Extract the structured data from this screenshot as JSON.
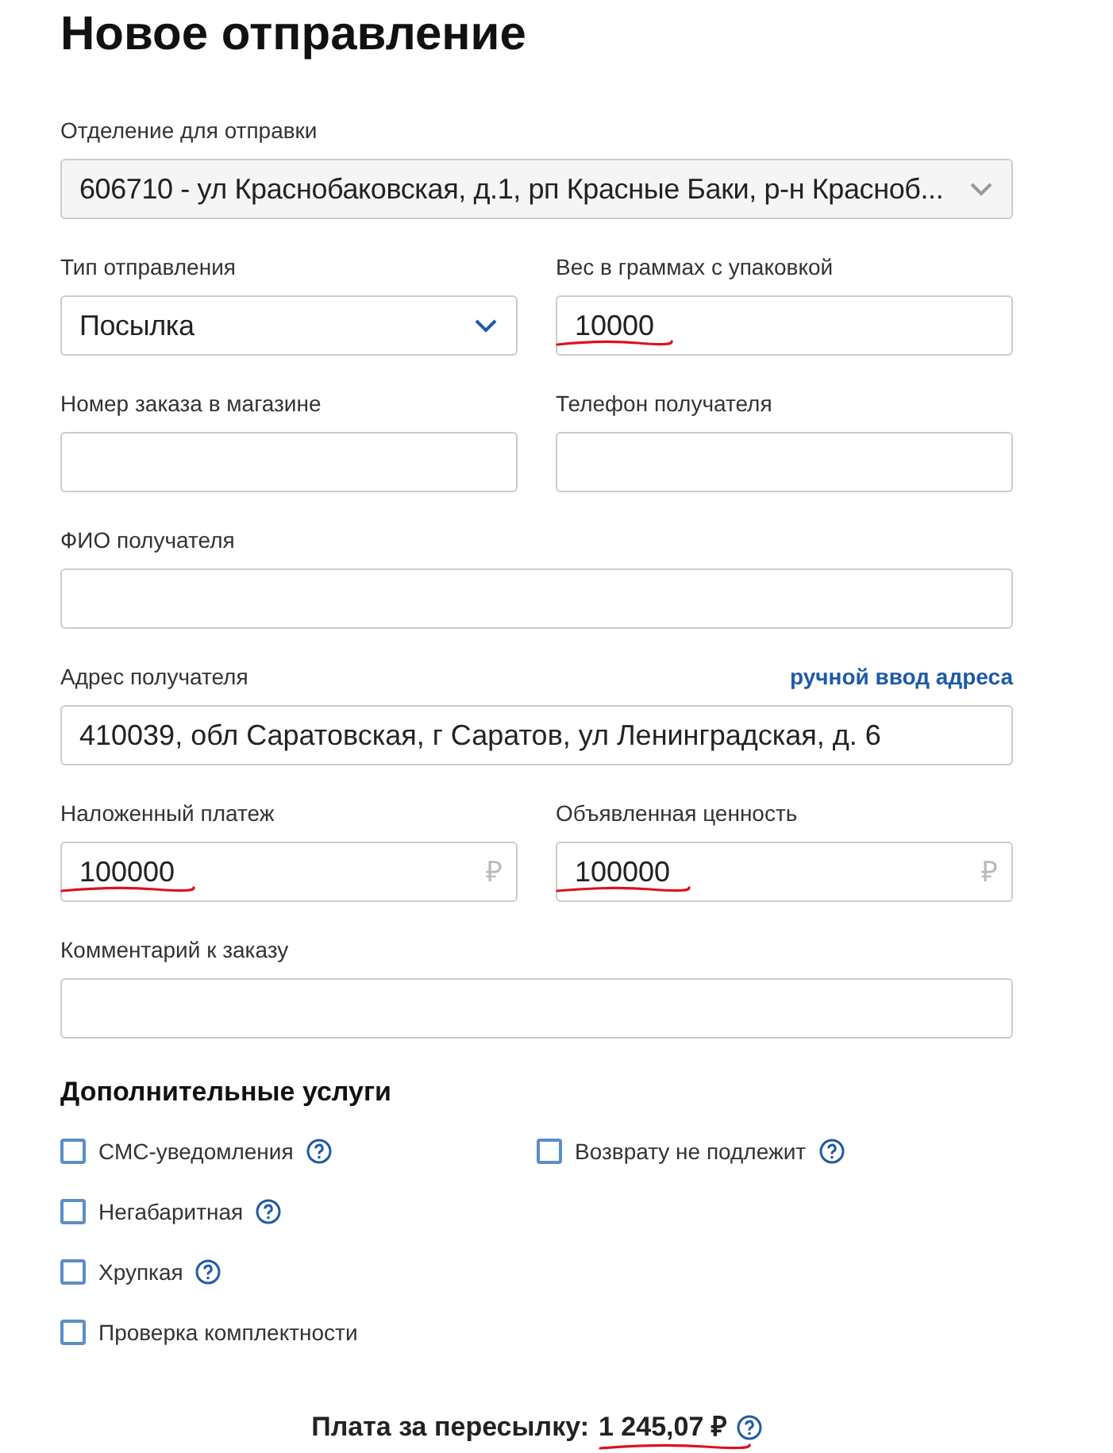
{
  "title": "Новое отправление",
  "rows": [
    [
      {
        "kind": "select",
        "label": "Отделение для отправки",
        "value": "606710 - ул Краснобаковская, д.1, рп Красные Баки, р-н Красноб...",
        "disabled": true
      }
    ],
    [
      {
        "kind": "select",
        "label": "Тип отправления",
        "value": "Посылка",
        "disabled": false
      },
      {
        "kind": "input",
        "label": "Вес в граммах с упаковкой",
        "value": "10000",
        "marked": true
      }
    ],
    [
      {
        "kind": "input",
        "label": "Номер заказа в магазине",
        "marked": false
      },
      {
        "kind": "input",
        "label": "Телефон получателя",
        "marked": false
      }
    ],
    [
      {
        "kind": "input",
        "label": "ФИО получателя",
        "marked": false
      }
    ],
    [
      {
        "kind": "input",
        "label": "Адрес получателя",
        "link": "ручной ввод адреса",
        "value": "410039, обл Саратовская, г Саратов, ул Ленинградская, д. 6"
      }
    ],
    [
      {
        "kind": "money",
        "label": "Наложенный платеж",
        "value": "100000",
        "suffix": "₽",
        "marked": true
      },
      {
        "kind": "money",
        "label": "Объявленная ценность",
        "value": "100000",
        "suffix": "₽",
        "marked": true
      }
    ],
    [
      {
        "kind": "input",
        "label": "Комментарий к заказу",
        "marked": false
      }
    ]
  ],
  "services": {
    "title": "Дополнительные услуги",
    "columns": [
      [
        {
          "label": "СМС-уведомления",
          "checked": false,
          "help": true
        },
        {
          "label": "Негабаритная",
          "checked": false,
          "help": true
        },
        {
          "label": "Хрупкая",
          "checked": false,
          "help": true
        },
        {
          "label": "Проверка комплектности",
          "checked": false,
          "help": false
        }
      ],
      [
        {
          "label": "Возврату не подлежит",
          "checked": false,
          "help": true
        }
      ]
    ]
  },
  "fee": {
    "label": "Плата за пересылку:",
    "value": "1 245,07 ₽",
    "marked": true,
    "help": true
  }
}
